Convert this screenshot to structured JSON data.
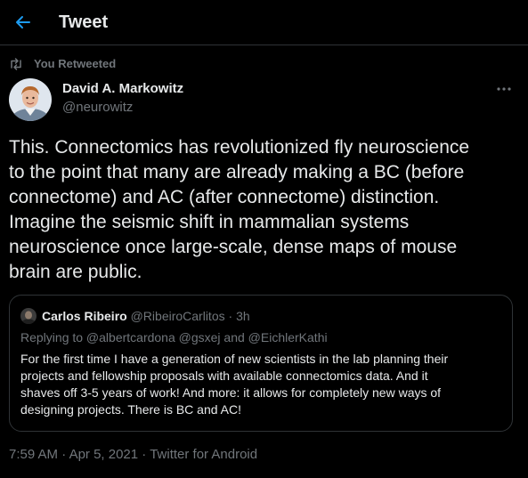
{
  "header": {
    "title": "Tweet",
    "back_icon": "back-arrow-icon"
  },
  "retweet": {
    "icon": "retweet-icon",
    "label": "You Retweeted"
  },
  "tweet": {
    "author": {
      "name": "David A. Markowitz",
      "handle": "@neurowitz"
    },
    "more_icon": "more-options-icon",
    "text_lines": [
      "This. Connectomics has revolutionized fly neuroscience",
      "to the point that many are already making a BC (before",
      "connectome) and AC (after connectome) distinction.",
      "Imagine the seismic shift in mammalian systems",
      "neuroscience once large-scale, dense maps of mouse",
      "brain are public."
    ],
    "time": "7:59 AM",
    "date": "Apr 5, 2021",
    "separator": "·",
    "source": "Twitter for Android"
  },
  "quote": {
    "author": {
      "name": "Carlos Ribeiro",
      "handle": "@RibeiroCarlitos",
      "separator": "·",
      "time": "3h"
    },
    "replying_to": "Replying to @albertcardona @gsxej and @EichlerKathi",
    "text_lines": [
      "For the first time I have a generation of new scientists in the lab planning their",
      "projects and fellowship proposals with available connectomics data. And it",
      "shaves off 3-5 years of work! And more: it allows for completely new ways of",
      "designing projects. There is BC and AC!"
    ]
  },
  "colors": {
    "background": "#000000",
    "text_primary": "#e7e9ea",
    "text_secondary": "#71767b",
    "accent": "#1d9bf0",
    "border": "#2f3336"
  }
}
